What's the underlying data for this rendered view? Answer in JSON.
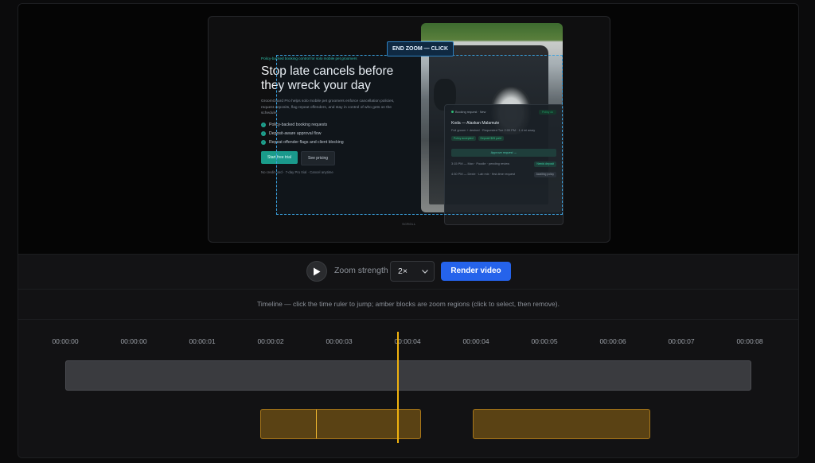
{
  "preview": {
    "hero": {
      "eyebrow": "Policy-backed booking control for solo mobile pet groomers",
      "headline_line1": "Stop late cancels before",
      "headline_line2": "they wreck your day",
      "body": "GroomGuard Pro helps solo mobile pet groomers enforce cancellation policies, request deposits, flag repeat offenders, and stay in control of who gets on the schedule.",
      "features": [
        "Policy-backed booking requests",
        "Deposit-aware approval flow",
        "Repeat offender flags and client blocking"
      ],
      "primary_cta": "Start free trial",
      "secondary_cta": "See pricing",
      "fine_print": "No credit card · 7-day Pro trial · Cancel anytime"
    },
    "card": {
      "header": "Booking request · New",
      "status_pill": "Policy ok",
      "title": "Koda — Alaskan Malamute",
      "subtitle": "Full groom + deshed · Requested Tue 2:00 PM · 1.4 mi away",
      "tags": [
        "Policy accepted",
        "Deposit $25 paid"
      ],
      "approve": "Approve request →",
      "rows": [
        {
          "text": "3:15 PM — Max · Poodle · pending review",
          "badge": "Needs deposit"
        },
        {
          "text": "4:30 PM — Dexie · Lab mix · first-time request",
          "badge": "Awaiting policy"
        }
      ]
    },
    "zoom_label": "END ZOOM — CLICK",
    "scroll_hint": "SCROLL"
  },
  "controls": {
    "zoom_strength_label": "Zoom strength",
    "zoom_value": "2×",
    "render_label": "Render video"
  },
  "hint": "Timeline — click the time ruler to jump; amber blocks are zoom regions (click to select, then remove).",
  "timeline": {
    "ticks": [
      "00:00:00",
      "00:00:00",
      "00:00:01",
      "00:00:02",
      "00:00:03",
      "00:00:04",
      "00:00:04",
      "00:00:05",
      "00:00:06",
      "00:00:07",
      "00:00:08"
    ],
    "regions": [
      {
        "start": 2.85,
        "end": 5.2,
        "marker": 3.65
      },
      {
        "start": 5.95,
        "end": 8.55
      }
    ],
    "duration": 10,
    "playhead": 4.85
  },
  "colors": {
    "accent": "#2563eb",
    "teal": "#1a9c8a",
    "amber": "#f0b20f",
    "zoom_outline": "#3aa2e0"
  }
}
